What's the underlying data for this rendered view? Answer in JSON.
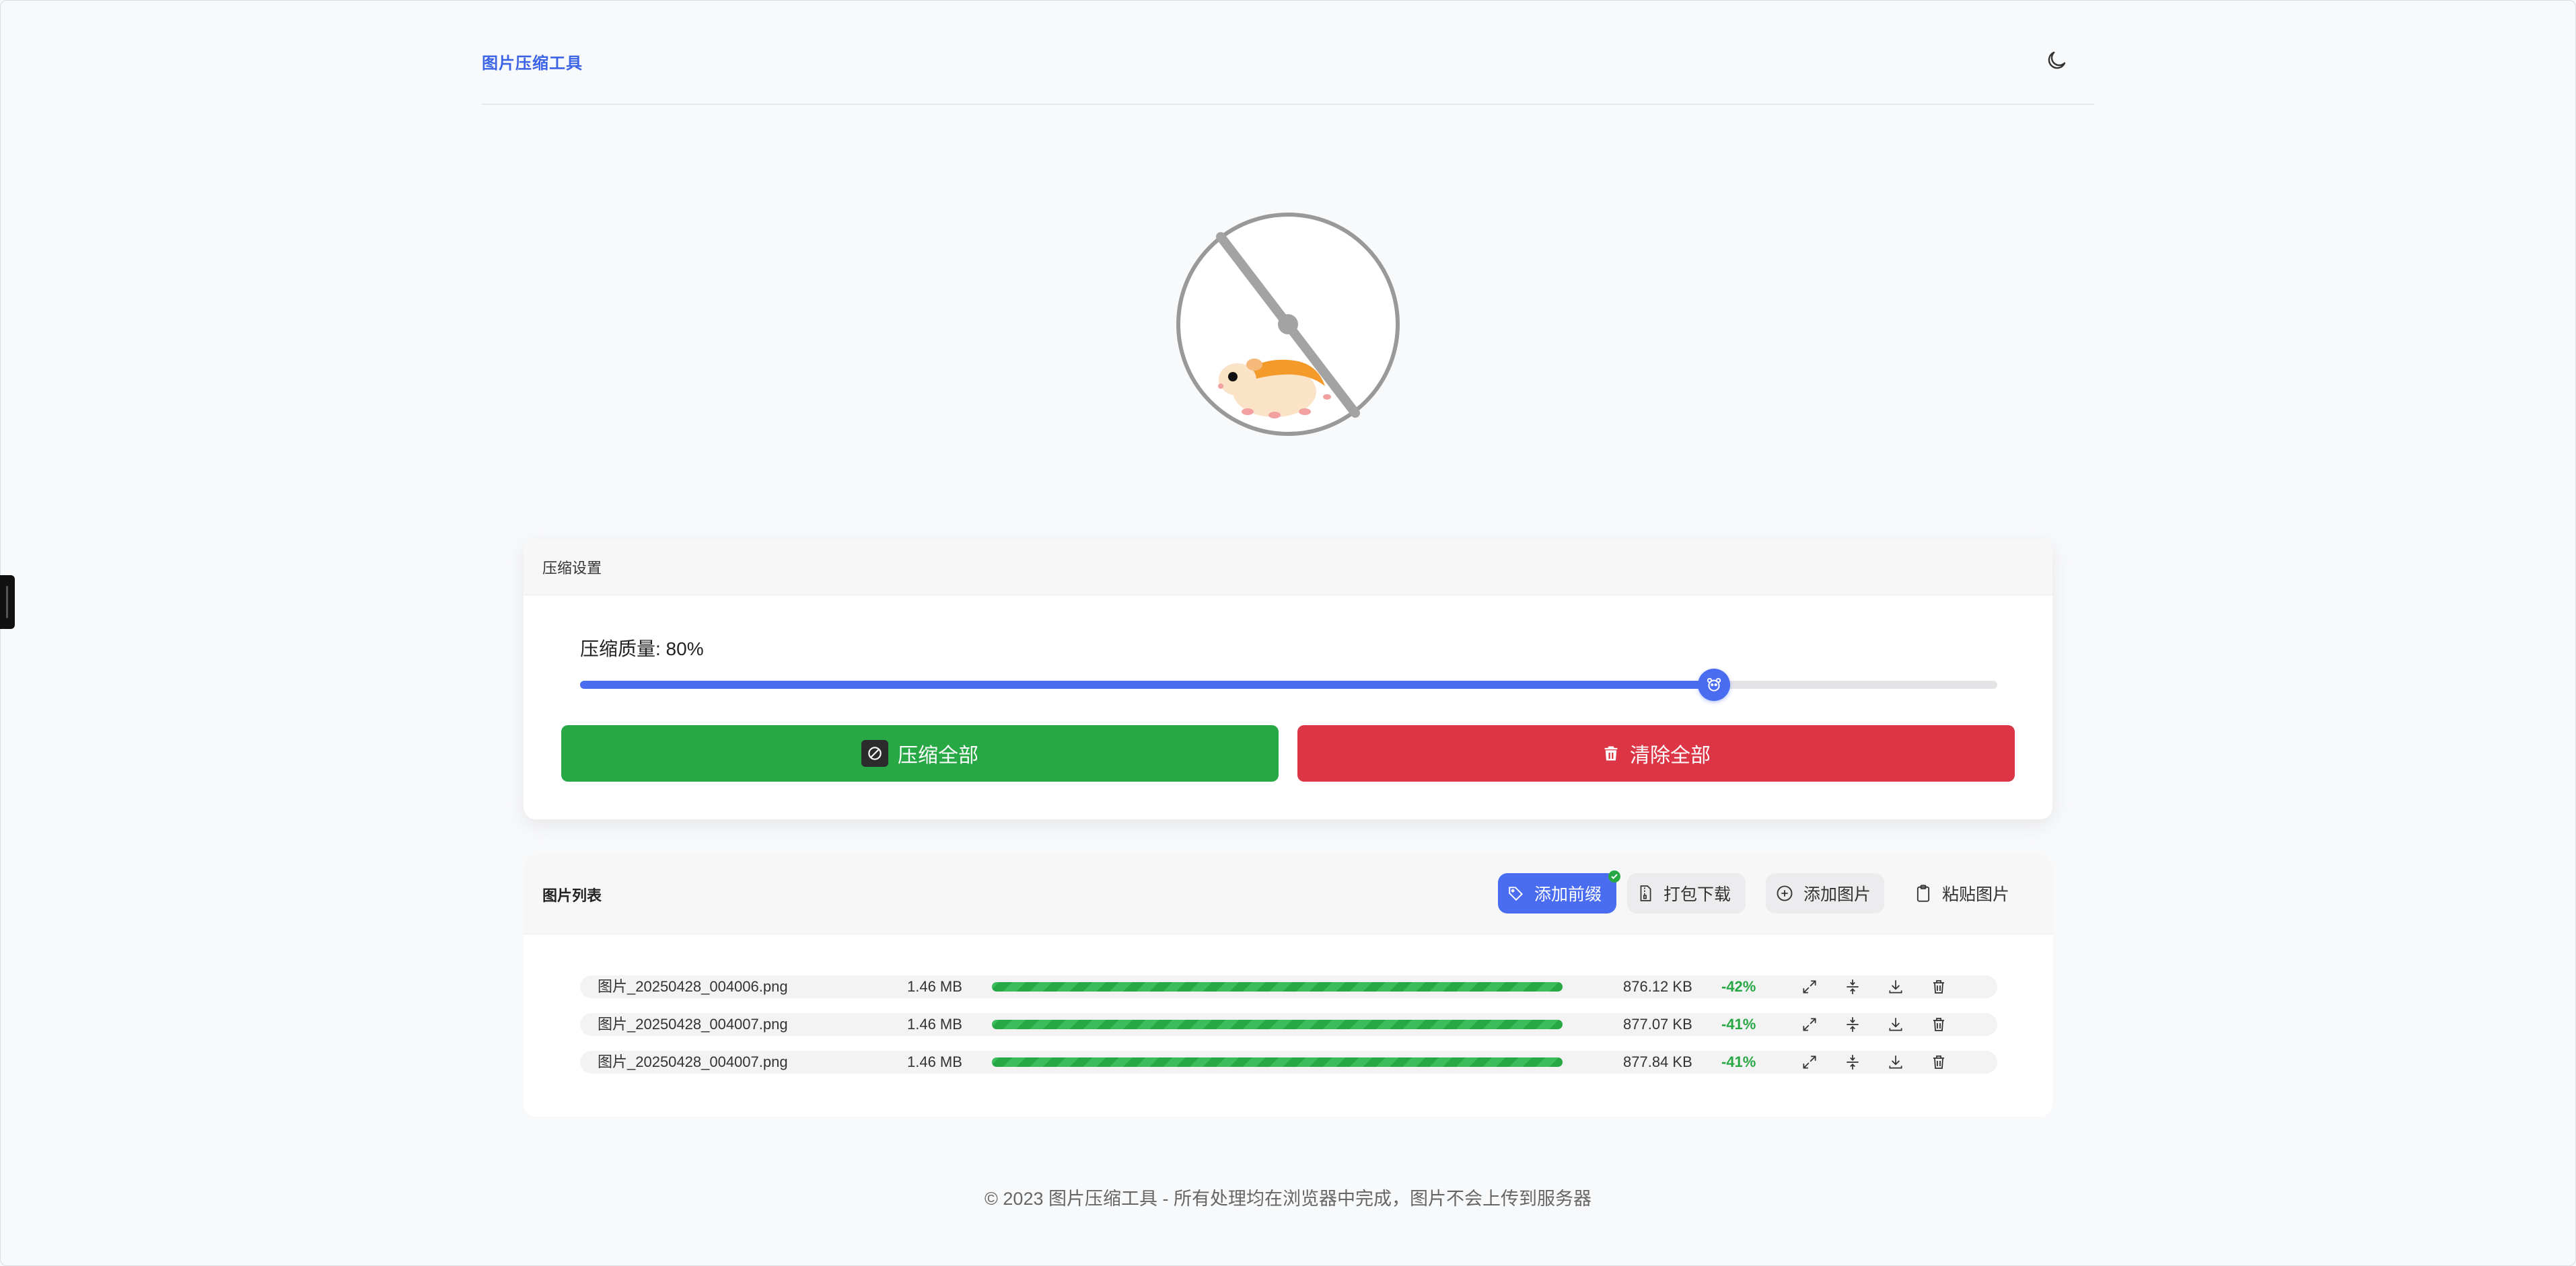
{
  "header": {
    "brand": "图片压缩工具",
    "theme_icon": "moon-icon"
  },
  "settings": {
    "title": "压缩设置",
    "quality_label": "压缩质量: 80%",
    "quality_value": 80,
    "compress_all_label": "压缩全部",
    "clear_all_label": "清除全部"
  },
  "list": {
    "title": "图片列表",
    "actions": {
      "prefix": "添加前缀",
      "zip": "打包下载",
      "add": "添加图片",
      "paste": "粘贴图片"
    },
    "files": [
      {
        "name": "图片_20250428_004006.png",
        "original_size": "1.46 MB",
        "progress": 100,
        "compressed_size": "876.12 KB",
        "ratio": "-42%"
      },
      {
        "name": "图片_20250428_004007.png",
        "original_size": "1.46 MB",
        "progress": 100,
        "compressed_size": "877.07 KB",
        "ratio": "-41%"
      },
      {
        "name": "图片_20250428_004007.png",
        "original_size": "1.46 MB",
        "progress": 100,
        "compressed_size": "877.84 KB",
        "ratio": "-41%"
      }
    ]
  },
  "footer": {
    "text": "© 2023 图片压缩工具 - 所有处理均在浏览器中完成，图片不会上传到服务器"
  },
  "colors": {
    "primary": "#4a6cf0",
    "success": "#28a745",
    "danger": "#dc3545",
    "brand_text": "#3b63e6",
    "background": "#f8f9fb"
  }
}
